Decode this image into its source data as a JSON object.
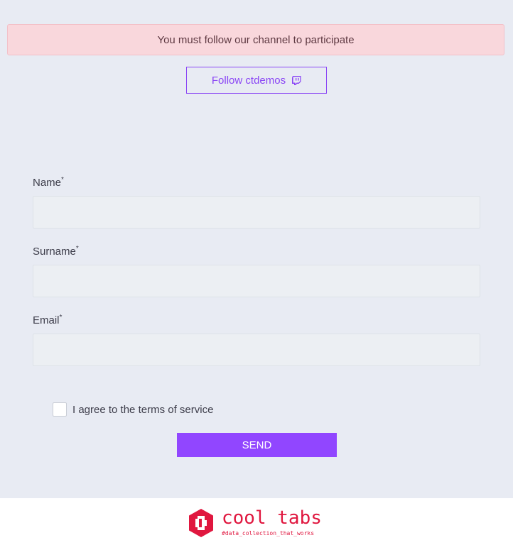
{
  "alert": {
    "message": "You must follow our channel to participate"
  },
  "follow": {
    "label": "Follow ctdemos",
    "icon": "twitch-icon"
  },
  "form": {
    "name": {
      "label": "Name",
      "required_mark": "*",
      "value": "",
      "placeholder": ""
    },
    "surname": {
      "label": "Surname",
      "required_mark": "*",
      "value": "",
      "placeholder": ""
    },
    "email": {
      "label": "Email",
      "required_mark": "*",
      "value": "",
      "placeholder": ""
    },
    "terms": {
      "label": "I agree to the terms of service",
      "checked": false
    },
    "submit": {
      "label": "SEND"
    }
  },
  "footer": {
    "brand_name": "cool tabs",
    "tagline": "#data_collection_that_works",
    "logo_icon": "cooltabs-hexagon-logo"
  },
  "colors": {
    "accent": "#9146ff",
    "alert_bg": "#f9d7dc",
    "page_bg": "#e8ebf3",
    "brand": "#e0173f"
  }
}
